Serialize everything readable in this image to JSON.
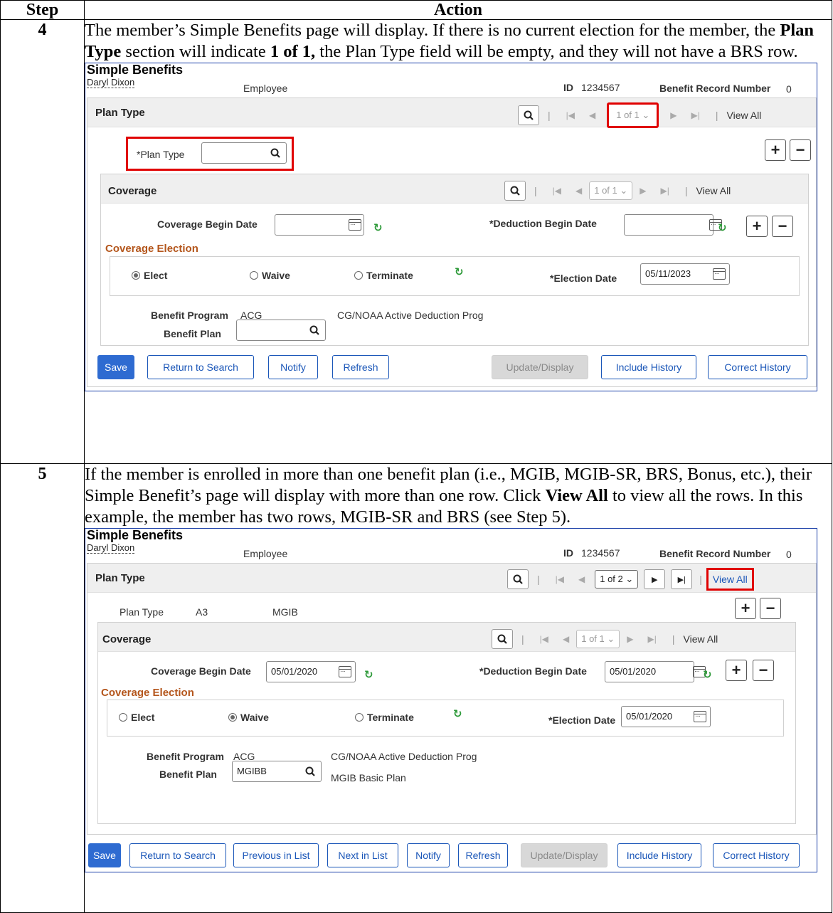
{
  "table": {
    "headers": [
      "Step",
      "Action"
    ],
    "steps": [
      {
        "number": "4",
        "text_html": "The member’s Simple Benefits page will display. If there is no current election for the member, the <b>Plan Type</b> section will indicate <b>1 of 1,</b> the Plan Type field will be empty, and they will not have a BRS row."
      },
      {
        "number": "5",
        "text_html": "If the member is enrolled in more than one benefit plan (i.e., MGIB, MGIB-SR, BRS, Bonus, etc.), their Simple Benefit’s page will display with more than one row. Click <b>View All</b> to view all the rows. In this example, the member has two rows, MGIB-SR and BRS (see Step 5)."
      }
    ]
  },
  "screens": [
    {
      "title": "Simple Benefits",
      "name": "Daryl Dixon",
      "employee_label": "Employee",
      "id_label": "ID",
      "id_value": "1234567",
      "brn_label": "Benefit Record Number",
      "brn_value": "0",
      "plan_header": "Plan Type",
      "plan_nav": {
        "count": "1 of 1",
        "view_all": "View All"
      },
      "plan_type_label": "*Plan Type",
      "plan_type_value": "",
      "coverage_header": "Coverage",
      "coverage_nav": {
        "count": "1 of 1",
        "view_all": "View All"
      },
      "coverage_begin_label": "Coverage Begin Date",
      "coverage_begin_value": "",
      "deduction_begin_label": "*Deduction Begin Date",
      "deduction_begin_value": "",
      "coverage_election_title": "Coverage Election",
      "elect_label": "Elect",
      "waive_label": "Waive",
      "terminate_label": "Terminate",
      "selected_election": "Elect",
      "election_date_label": "*Election Date",
      "election_date_value": "05/11/2023",
      "benefit_program_label": "Benefit Program",
      "benefit_program_value": "ACG",
      "benefit_program_desc": "CG/NOAA Active Deduction Prog",
      "benefit_plan_label": "Benefit Plan",
      "benefit_plan_value": "",
      "benefit_plan_desc": "",
      "buttons": {
        "save": "Save",
        "return_to_search": "Return to Search",
        "notify": "Notify",
        "refresh": "Refresh",
        "update_display": "Update/Display",
        "include_history": "Include History",
        "correct_history": "Correct History"
      }
    },
    {
      "title": "Simple Benefits",
      "name": "Daryl Dixon",
      "employee_label": "Employee",
      "id_label": "ID",
      "id_value": "1234567",
      "brn_label": "Benefit Record Number",
      "brn_value": "0",
      "plan_header": "Plan Type",
      "plan_nav": {
        "count": "1 of 2",
        "view_all": "View All"
      },
      "plan_type_label": "Plan Type",
      "plan_type_value": "A3",
      "plan_type_desc": "MGIB",
      "coverage_header": "Coverage",
      "coverage_nav": {
        "count": "1 of 1",
        "view_all": "View All"
      },
      "coverage_begin_label": "Coverage Begin Date",
      "coverage_begin_value": "05/01/2020",
      "deduction_begin_label": "*Deduction Begin Date",
      "deduction_begin_value": "05/01/2020",
      "coverage_election_title": "Coverage Election",
      "elect_label": "Elect",
      "waive_label": "Waive",
      "terminate_label": "Terminate",
      "selected_election": "Waive",
      "election_date_label": "*Election Date",
      "election_date_value": "05/01/2020",
      "benefit_program_label": "Benefit Program",
      "benefit_program_value": "ACG",
      "benefit_program_desc": "CG/NOAA Active Deduction Prog",
      "benefit_plan_label": "Benefit Plan",
      "benefit_plan_value": "MGIBB",
      "benefit_plan_desc": "MGIB Basic Plan",
      "buttons": {
        "save": "Save",
        "return_to_search": "Return to Search",
        "previous_in_list": "Previous in List",
        "next_in_list": "Next in List",
        "notify": "Notify",
        "refresh": "Refresh",
        "update_display": "Update/Display",
        "include_history": "Include History",
        "correct_history": "Correct History"
      }
    }
  ],
  "icons": {
    "search": "magnifier-icon",
    "calendar": "calendar-icon",
    "refresh": "refresh-icon",
    "add": "plus-icon",
    "remove": "minus-icon"
  },
  "colors": {
    "highlight": "#e00000",
    "primary_button": "#2e6bd1",
    "link": "#1a56b8",
    "coverage_election": "#b4561c",
    "refresh_icon": "#2e9a3a"
  }
}
